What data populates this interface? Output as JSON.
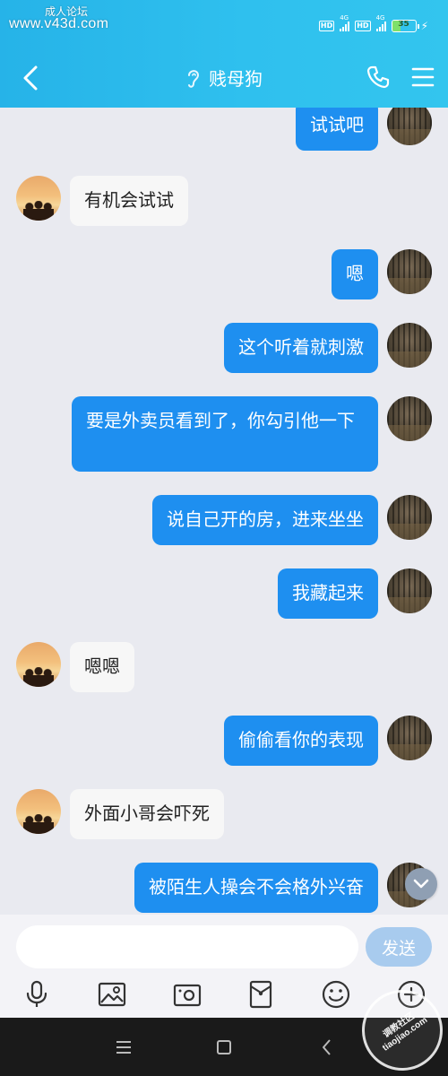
{
  "watermark": {
    "line1": "成人论坛",
    "url": "www.v43d.com",
    "corner": "调教社区 tiaojiao.com"
  },
  "status": {
    "net1": "4G",
    "net2": "4G",
    "hd": "HD",
    "battery_percent": 35,
    "battery_text": "35"
  },
  "header": {
    "title": "贱母狗"
  },
  "messages": [
    {
      "side": "sent",
      "text": "试试吧"
    },
    {
      "side": "recv",
      "text": "有机会试试"
    },
    {
      "side": "sent",
      "text": "嗯"
    },
    {
      "side": "sent",
      "text": "这个听着就刺激"
    },
    {
      "side": "sent",
      "text": "要是外卖员看到了，你勾引他一下"
    },
    {
      "side": "sent",
      "text": "说自己开的房，进来坐坐"
    },
    {
      "side": "sent",
      "text": "我藏起来"
    },
    {
      "side": "recv",
      "text": "嗯嗯"
    },
    {
      "side": "sent",
      "text": "偷偷看你的表现"
    },
    {
      "side": "recv",
      "text": "外面小哥会吓死"
    },
    {
      "side": "sent",
      "text": "被陌生人操会不会格外兴奋"
    }
  ],
  "composer": {
    "input_value": "",
    "send_label": "发送"
  },
  "toolbar_icons": [
    "microphone-icon",
    "image-icon",
    "camera-icon",
    "red-packet-icon",
    "emoji-icon",
    "plus-icon"
  ],
  "colors": {
    "header": "#2fc0ee",
    "sent_bubble": "#1e8ff0",
    "recv_bubble": "#f7f7f7",
    "send_button": "#a8cbee"
  }
}
